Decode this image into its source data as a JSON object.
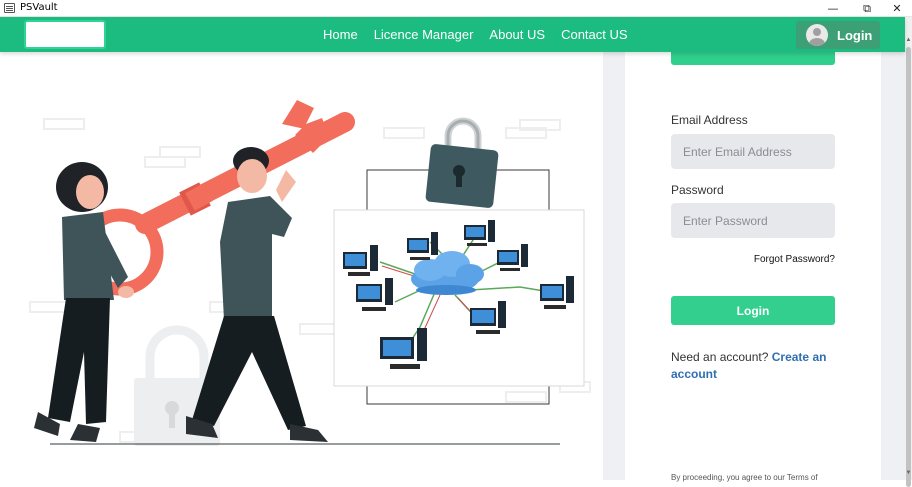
{
  "window": {
    "title": "PSVault",
    "minimize_glyph": "—",
    "maximize_glyph": "⧉",
    "close_glyph": "✕"
  },
  "navbar": {
    "links": [
      "Home",
      "Licence Manager",
      "About US",
      "Contact US"
    ],
    "login_label": "Login",
    "brand_color": "#1cbb80"
  },
  "form": {
    "email_label": "Email Address",
    "email_placeholder": "Enter Email Address",
    "password_label": "Password",
    "password_placeholder": "Enter Password",
    "forgot_label": "Forgot Password?",
    "login_button": "Login",
    "need_account_text": "Need an account?",
    "create_account_link": "Create an account",
    "terms_text": "By proceeding, you agree to our Terms of"
  },
  "colors": {
    "accent": "#33cf8e",
    "link": "#2f6fb1",
    "key": "#f26d5b"
  },
  "icons": {
    "avatar": "user-avatar-icon",
    "illustration": "people-carrying-key-with-padlock-and-cloud-network"
  }
}
